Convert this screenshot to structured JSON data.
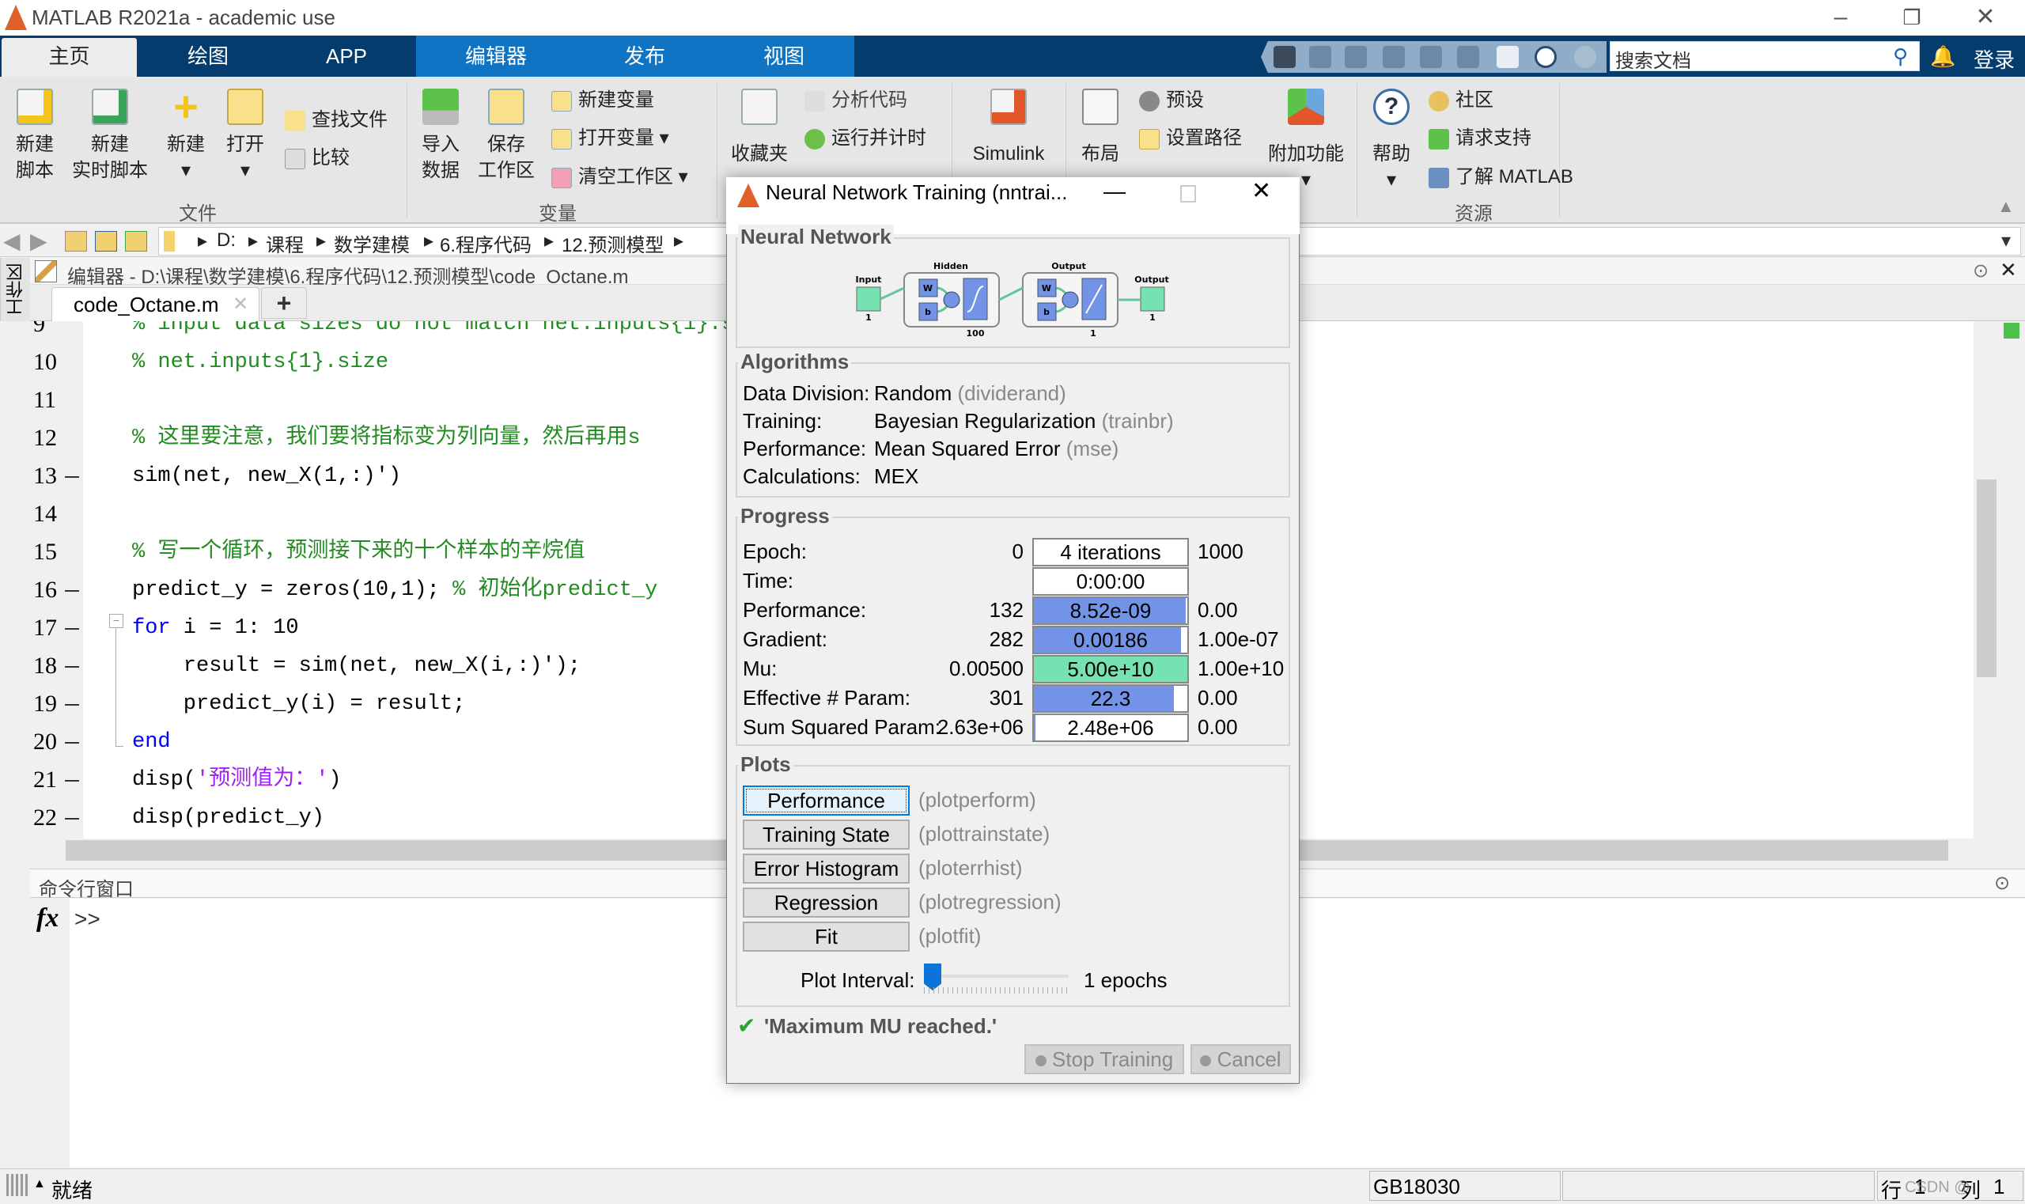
{
  "window": {
    "title": "MATLAB R2021a - academic use",
    "minimize": "–",
    "maximize": "❐",
    "close": "✕"
  },
  "tabs": [
    {
      "label": "主页",
      "selected": true
    },
    {
      "label": "绘图"
    },
    {
      "label": "APP"
    },
    {
      "label": "编辑器"
    },
    {
      "label": "发布"
    },
    {
      "label": "视图"
    }
  ],
  "header": {
    "search_placeholder": "搜索文档",
    "login": "登录"
  },
  "ribbon": {
    "file": {
      "group": "文件",
      "new_script": [
        "新建",
        "脚本"
      ],
      "new_live_script": [
        "新建",
        "实时脚本"
      ],
      "new": "新建",
      "open": "打开",
      "find_files": "查找文件",
      "compare": "比较"
    },
    "variable": {
      "group": "变量",
      "import": [
        "导入",
        "数据"
      ],
      "save": [
        "保存",
        "工作区"
      ],
      "new_var": "新建变量",
      "open_var": "打开变量",
      "clear_ws": "清空工作区"
    },
    "code": {
      "favorites": "收藏夹",
      "analyze": "分析代码",
      "run_time": "运行并计时"
    },
    "simulink": "Simulink",
    "env": {
      "layout": "布局",
      "preferences": "预设",
      "set_path": "设置路径",
      "addons": "附加功能"
    },
    "resources": {
      "group": "资源",
      "help": "帮助",
      "community": "社区",
      "support": "请求支持",
      "learn": "了解 MATLAB"
    }
  },
  "address": {
    "crumbs": [
      "D:",
      "课程",
      "数学建模",
      "6.程序代码",
      "12.预测模型"
    ]
  },
  "editor": {
    "title": "编辑器 - D:\\课程\\数学建模\\6.程序代码\\12.预测模型\\code_Octane.m",
    "side_label": "工作区",
    "file_tab": "code_Octane.m",
    "new_tab": "+",
    "lines": [
      {
        "n": "9",
        "exec": false,
        "seg": [
          {
            "t": "% input data sizes do not match net.inputs{1}.s",
            "c": "cm"
          }
        ]
      },
      {
        "n": "10",
        "exec": false,
        "seg": [
          {
            "t": "% net.inputs{1}.size",
            "c": "cm"
          }
        ]
      },
      {
        "n": "11",
        "exec": false,
        "seg": []
      },
      {
        "n": "12",
        "exec": false,
        "seg": [
          {
            "t": "% 这里要注意，我们要将指标变为列向量，然后再用s",
            "c": "cm"
          }
        ]
      },
      {
        "n": "13",
        "exec": true,
        "seg": [
          {
            "t": "sim(net, new_X(1,:)')",
            "c": ""
          }
        ]
      },
      {
        "n": "14",
        "exec": false,
        "seg": []
      },
      {
        "n": "15",
        "exec": false,
        "seg": [
          {
            "t": "% 写一个循环，预测接下来的十个样本的辛烷值",
            "c": "cm"
          }
        ]
      },
      {
        "n": "16",
        "exec": true,
        "seg": [
          {
            "t": "predict_y = zeros(10,1); ",
            "c": ""
          },
          {
            "t": "% 初始化predict_y",
            "c": "cm"
          }
        ]
      },
      {
        "n": "17",
        "exec": true,
        "seg": [
          {
            "t": "for",
            "c": "kw"
          },
          {
            "t": " i = 1: 10",
            "c": ""
          }
        ]
      },
      {
        "n": "18",
        "exec": true,
        "seg": [
          {
            "t": "    result = sim(net, new_X(i,:)');",
            "c": ""
          }
        ]
      },
      {
        "n": "19",
        "exec": true,
        "seg": [
          {
            "t": "    predict_y(i) = result;",
            "c": ""
          }
        ]
      },
      {
        "n": "20",
        "exec": true,
        "seg": [
          {
            "t": "end",
            "c": "kw"
          }
        ]
      },
      {
        "n": "21",
        "exec": true,
        "seg": [
          {
            "t": "disp(",
            "c": ""
          },
          {
            "t": "'预测值为：'",
            "c": "str"
          },
          {
            "t": ")",
            "c": ""
          }
        ]
      },
      {
        "n": "22",
        "exec": true,
        "seg": [
          {
            "t": "disp(predict_y)",
            "c": ""
          }
        ]
      }
    ]
  },
  "command_window": {
    "title": "命令行窗口",
    "fx": "fx",
    "prompt": ">>"
  },
  "status": {
    "ready": "就绪",
    "encoding": "GB18030",
    "row_label": "行",
    "row": "1",
    "col_label": "列",
    "col": "1",
    "watermark": "CSDN @"
  },
  "dialog": {
    "title": "Neural Network Training (nntrai...",
    "network": {
      "heading": "Neural Network",
      "input_label": "Input",
      "input_size": "1",
      "hidden_label": "Hidden",
      "hidden_size": "100",
      "output_layer_label": "Output",
      "output_layer_size": "1",
      "output_label": "Output",
      "output_size": "1",
      "weight": "W",
      "bias": "b"
    },
    "algorithms": {
      "heading": "Algorithms",
      "rows": [
        {
          "label": "Data Division:",
          "value": "Random",
          "fn": "(dividerand)"
        },
        {
          "label": "Training:",
          "value": "Bayesian Regularization",
          "fn": "(trainbr)"
        },
        {
          "label": "Performance:",
          "value": "Mean Squared Error",
          "fn": "(mse)"
        },
        {
          "label": "Calculations:",
          "value": "MEX",
          "fn": ""
        }
      ]
    },
    "progress": {
      "heading": "Progress",
      "rows": [
        {
          "label": "Epoch:",
          "start": "0",
          "current": "4 iterations",
          "end": "1000",
          "fill": 0,
          "color": "#ffffff"
        },
        {
          "label": "Time:",
          "start": "",
          "current": "0:00:00",
          "end": "",
          "fill": 0,
          "color": "#ffffff"
        },
        {
          "label": "Performance:",
          "start": "132",
          "current": "8.52e-09",
          "end": "0.00",
          "fill": 0.99,
          "color": "#7393e6"
        },
        {
          "label": "Gradient:",
          "start": "282",
          "current": "0.00186",
          "end": "1.00e-07",
          "fill": 0.96,
          "color": "#7393e6"
        },
        {
          "label": "Mu:",
          "start": "0.00500",
          "current": "5.00e+10",
          "end": "1.00e+10",
          "fill": 1.0,
          "color": "#76e2b2"
        },
        {
          "label": "Effective # Param:",
          "start": "301",
          "current": "22.3",
          "end": "0.00",
          "fill": 0.91,
          "color": "#7393e6"
        },
        {
          "label": "Sum Squared Param:",
          "start": "2.63e+06",
          "current": "2.48e+06",
          "end": "0.00",
          "fill": 0.01,
          "color": "#7393e6"
        }
      ]
    },
    "plots": {
      "heading": "Plots",
      "buttons": [
        {
          "label": "Performance",
          "fn": "(plotperform)"
        },
        {
          "label": "Training State",
          "fn": "(plottrainstate)"
        },
        {
          "label": "Error Histogram",
          "fn": "(ploterrhist)"
        },
        {
          "label": "Regression",
          "fn": "(plotregression)"
        },
        {
          "label": "Fit",
          "fn": "(plotfit)"
        }
      ],
      "interval_label": "Plot Interval:",
      "interval_value": "1 epochs",
      "interval_fraction": 0
    },
    "status_message": "'Maximum MU reached.'",
    "stop_button": "Stop Training",
    "cancel_button": "Cancel"
  }
}
